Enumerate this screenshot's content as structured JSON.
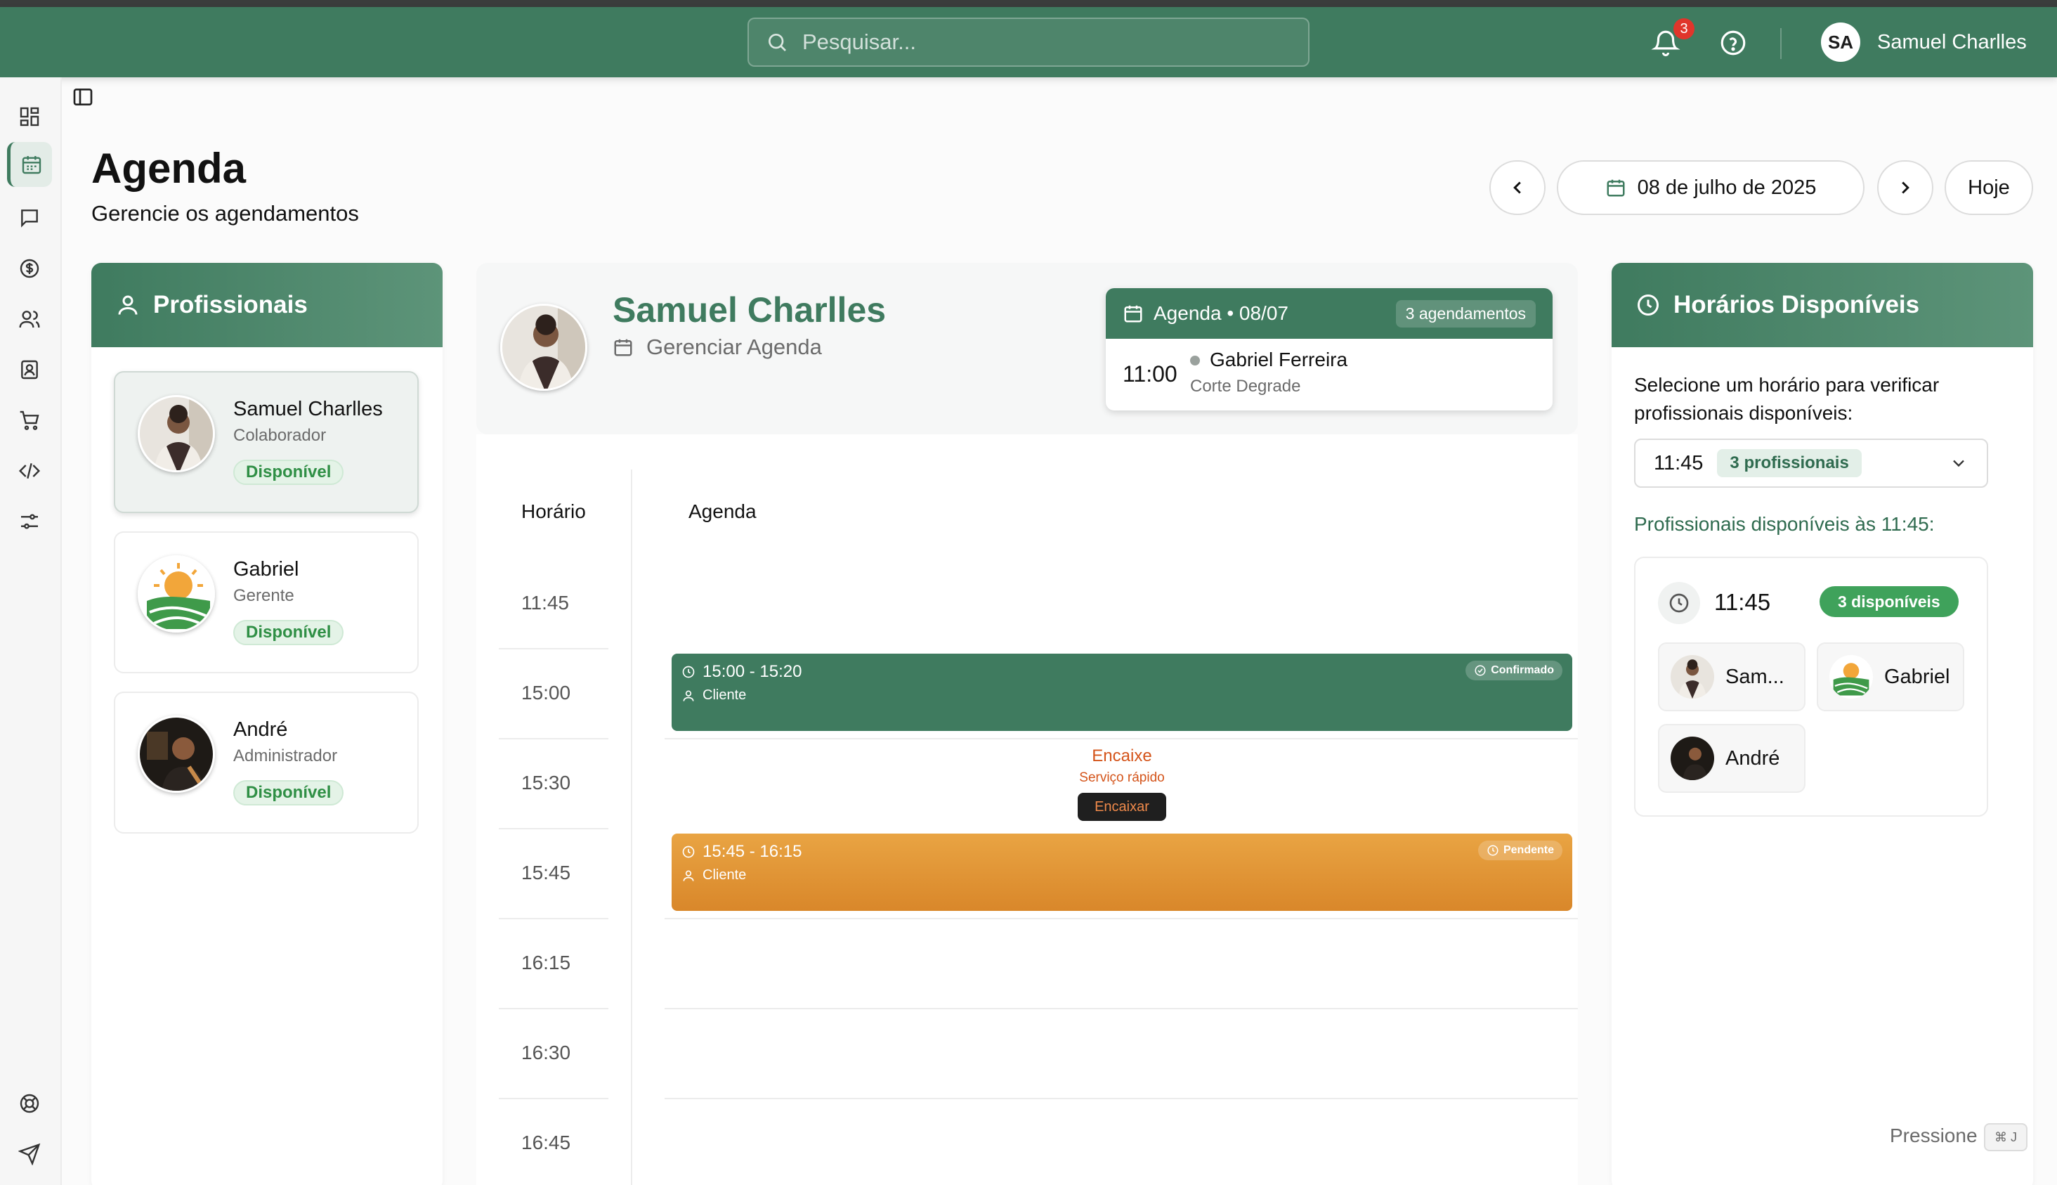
{
  "topbar": {
    "search_placeholder": "Pesquisar...",
    "notifications_count": "3",
    "user_initials": "SA",
    "user_name": "Samuel Charlles"
  },
  "sidebar": {
    "icons": [
      "dashboard-icon",
      "calendar-icon",
      "chat-icon",
      "dollar-icon",
      "users-icon",
      "contact-icon",
      "cart-icon",
      "code-icon",
      "sliders-icon",
      "support-icon",
      "send-icon"
    ],
    "active": "calendar-icon"
  },
  "header": {
    "title": "Agenda",
    "subtitle": "Gerencie os agendamentos",
    "date": "08 de julho de 2025",
    "today_label": "Hoje"
  },
  "professionals": {
    "heading": "Profissionais",
    "items": [
      {
        "name": "Samuel Charlles",
        "role": "Colaborador",
        "status": "Disponível",
        "selected": true
      },
      {
        "name": "Gabriel",
        "role": "Gerente",
        "status": "Disponível",
        "selected": false
      },
      {
        "name": "André",
        "role": "Administrador",
        "status": "Disponível",
        "selected": false
      }
    ]
  },
  "agenda": {
    "name": "Samuel Charlles",
    "subtitle": "Gerenciar Agenda",
    "mini": {
      "title": "Agenda • 08/07",
      "count": "3 agendamentos",
      "time": "11:00",
      "client": "Gabriel Ferreira",
      "service": "Corte Degrade"
    },
    "col_time": "Horário",
    "col_agenda": "Agenda",
    "times": [
      "11:45",
      "15:00",
      "15:30",
      "15:45",
      "16:15",
      "16:30",
      "16:45"
    ],
    "appointments": [
      {
        "time": "15:00 - 15:20",
        "client": "Cliente",
        "status": "Confirmado",
        "color": "#3f7b5f"
      },
      {
        "time": "15:45 - 16:15",
        "client": "Cliente",
        "status": "Pendente",
        "color": "#e39a3a"
      }
    ],
    "encaixe": {
      "title": "Encaixe",
      "subtitle": "Serviço rápido",
      "button": "Encaixar"
    }
  },
  "available": {
    "heading": "Horários Disponíveis",
    "instruction": "Selecione um horário para verificar profissionais disponíveis:",
    "selected_time": "11:45",
    "selected_badge": "3 profissionais",
    "list_label": "Profissionais disponíveis às 11:45:",
    "box_time": "11:45",
    "box_badge": "3 disponíveis",
    "chips": [
      "Sam...",
      "Gabriel",
      "André"
    ]
  },
  "footer": {
    "press_label": "Pressione",
    "shortcut": "⌘ J"
  }
}
